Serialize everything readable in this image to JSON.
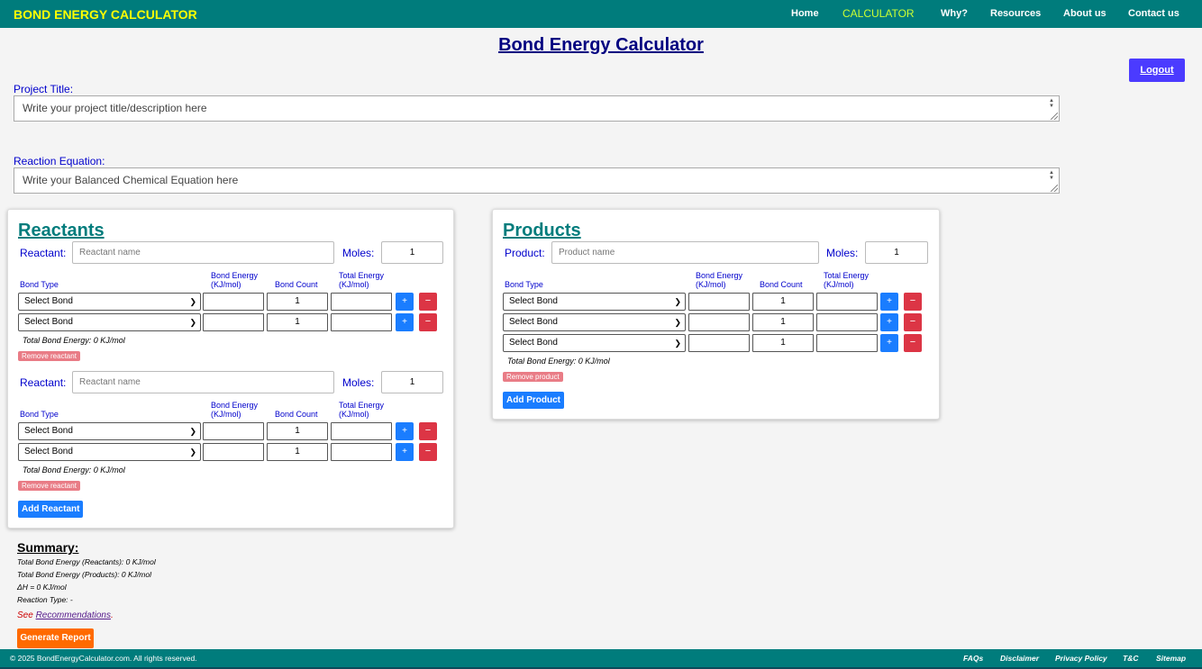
{
  "header": {
    "brand": "BOND ENERGY CALCULATOR",
    "nav": [
      "Home",
      "CALCULATOR",
      "Why?",
      "Resources",
      "About us",
      "Contact us"
    ],
    "active_nav": "CALCULATOR"
  },
  "page_title": "Bond Energy Calculator",
  "logout_label": "Logout",
  "project": {
    "label": "Project Title:",
    "placeholder": "Write your project title/description here"
  },
  "equation": {
    "label": "Reaction Equation:",
    "placeholder": "Write your Balanced Chemical Equation here"
  },
  "columns": {
    "bond_type": "Bond Type",
    "bond_energy": "Bond Energy (KJ/mol)",
    "bond_energy_line1": "Bond Energy",
    "bond_energy_line2": "(KJ/mol)",
    "bond_count": "Bond Count",
    "total_energy_line1": "Total Energy",
    "total_energy_line2": "(KJ/mol)"
  },
  "reactants": {
    "title": "Reactants",
    "row_label": "Reactant:",
    "name_placeholder": "Reactant name",
    "moles_label": "Moles:",
    "entries": [
      {
        "moles": "1",
        "bonds": [
          {
            "type": "Select Bond",
            "count": "1"
          },
          {
            "type": "Select Bond",
            "count": "1"
          }
        ],
        "total": "Total Bond Energy: 0 KJ/mol",
        "remove_label": "Remove reactant"
      },
      {
        "moles": "1",
        "bonds": [
          {
            "type": "Select Bond",
            "count": "1"
          },
          {
            "type": "Select Bond",
            "count": "1"
          }
        ],
        "total": "Total Bond Energy: 0 KJ/mol",
        "remove_label": "Remove reactant"
      }
    ],
    "add_label": "Add Reactant"
  },
  "products": {
    "title": "Products",
    "row_label": "Product:",
    "name_placeholder": "Product name",
    "moles_label": "Moles:",
    "entries": [
      {
        "moles": "1",
        "bonds": [
          {
            "type": "Select Bond",
            "count": "1"
          },
          {
            "type": "Select Bond",
            "count": "1"
          },
          {
            "type": "Select Bond",
            "count": "1"
          }
        ],
        "total": "Total Bond Energy: 0 KJ/mol",
        "remove_label": "Remove product"
      }
    ],
    "add_label": "Add Product"
  },
  "summary": {
    "title": "Summary:",
    "reactants_total": "Total Bond Energy (Reactants): 0 KJ/mol",
    "products_total": "Total Bond Energy (Products): 0 KJ/mol",
    "delta_h": "ΔH = 0 KJ/mol",
    "reaction_type": "Reaction Type: -",
    "see_prefix": "See",
    "recommendations_link": "Recommendations",
    "see_suffix": ".",
    "generate_label": "Generate Report"
  },
  "footer": {
    "copyright": "© 2025 BondEnergyCalculator.com. All rights reserved.",
    "links": [
      "FAQs",
      "Disclaimer",
      "Privacy Policy",
      "T&C",
      "Sitemap"
    ]
  },
  "colors": {
    "header_bg": "#007c7c",
    "brand": "#ffff00",
    "active_nav": "#ccff33",
    "plus_button": "#1a7dff",
    "minus_button": "#dc3545",
    "logout": "#4b3bff",
    "generate": "#ff6a00"
  },
  "icons": {
    "plus": "+",
    "minus": "−",
    "chevron": "chevron-down-icon"
  }
}
